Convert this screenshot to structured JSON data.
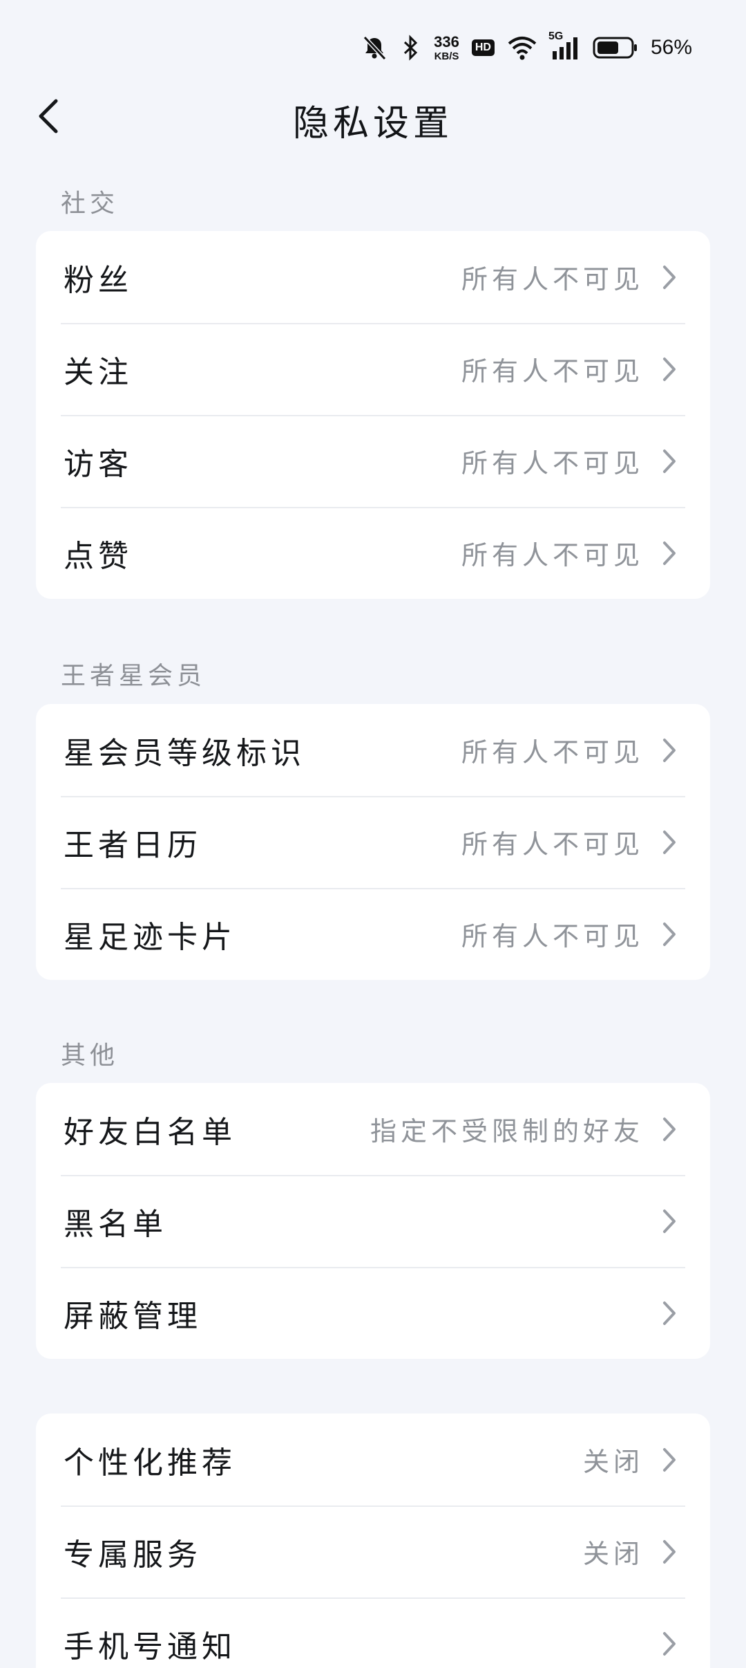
{
  "status_bar": {
    "net_speed_value": "336",
    "net_speed_unit": "KB/S",
    "hd_badge": "HD",
    "network_type": "5G",
    "battery_percent": "56%",
    "icons": [
      "bell-off-icon",
      "bluetooth-icon",
      "wifi-icon",
      "signal-icon",
      "battery-icon"
    ]
  },
  "header": {
    "title": "隐私设置",
    "back_icon": "chevron-left-icon"
  },
  "sections": {
    "social": {
      "label": "社交",
      "items": [
        {
          "label": "粉丝",
          "value": "所有人不可见"
        },
        {
          "label": "关注",
          "value": "所有人不可见"
        },
        {
          "label": "访客",
          "value": "所有人不可见"
        },
        {
          "label": "点赞",
          "value": "所有人不可见"
        }
      ]
    },
    "star_member": {
      "label": "王者星会员",
      "items": [
        {
          "label": "星会员等级标识",
          "value": "所有人不可见"
        },
        {
          "label": "王者日历",
          "value": "所有人不可见"
        },
        {
          "label": "星足迹卡片",
          "value": "所有人不可见"
        }
      ]
    },
    "other": {
      "label": "其他",
      "items": [
        {
          "label": "好友白名单",
          "value": "指定不受限制的好友"
        },
        {
          "label": "黑名单",
          "value": ""
        },
        {
          "label": "屏蔽管理",
          "value": ""
        }
      ]
    },
    "misc": {
      "items": [
        {
          "label": "个性化推荐",
          "value": "关闭"
        },
        {
          "label": "专属服务",
          "value": "关闭"
        },
        {
          "label": "手机号通知",
          "value": ""
        }
      ]
    }
  },
  "colors": {
    "background": "#f3f5fa",
    "card": "#ffffff",
    "primary_text": "#15171a",
    "secondary_text": "#8f9399",
    "chevron": "#9a9ea5"
  }
}
